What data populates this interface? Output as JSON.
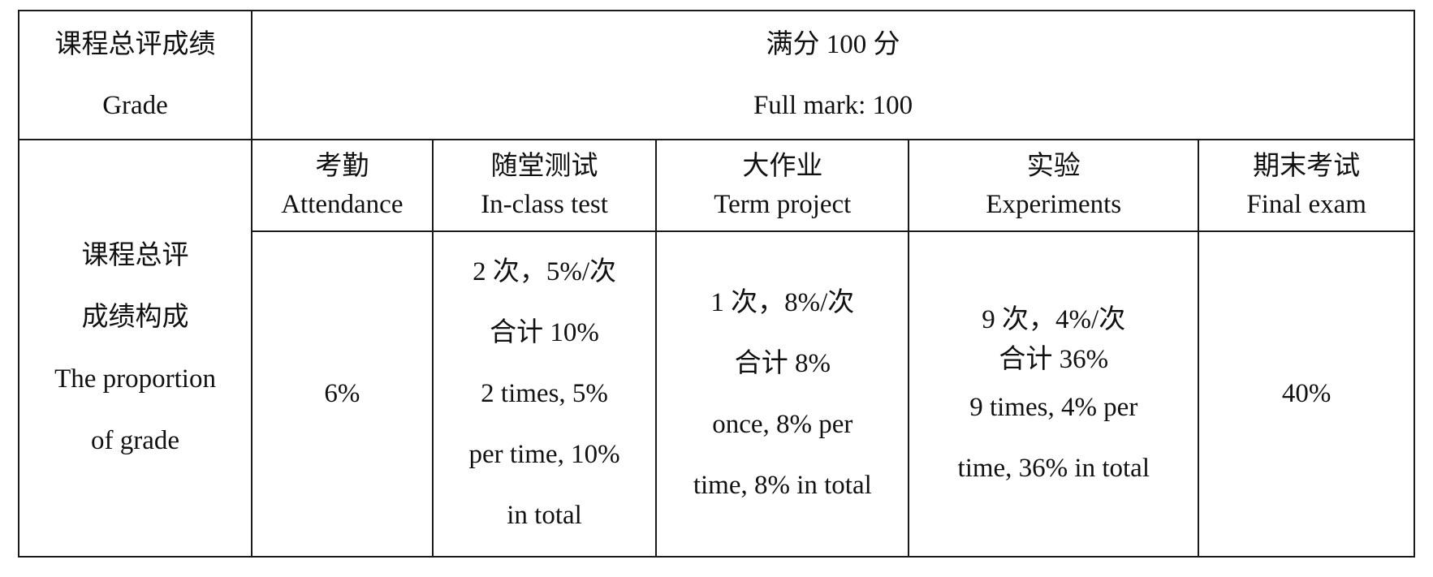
{
  "grade": {
    "label_zh": "课程总评成绩",
    "label_en": "Grade",
    "full_mark_zh": "满分 100 分",
    "full_mark_en": "Full mark: 100"
  },
  "proportion": {
    "label_lines": [
      "课程总评",
      "成绩构成",
      "The proportion",
      "of grade"
    ]
  },
  "components": [
    {
      "name_zh": "考勤",
      "name_en": "Attendance",
      "detail": [
        "6%"
      ]
    },
    {
      "name_zh": "随堂测试",
      "name_en": "In-class test",
      "detail": [
        "2 次，5%/次",
        "合计 10%",
        "2 times, 5%",
        "per time, 10%",
        "in total"
      ]
    },
    {
      "name_zh": "大作业",
      "name_en": "Term project",
      "detail": [
        "1 次，8%/次",
        "合计 8%",
        "once, 8% per",
        "time, 8% in total"
      ]
    },
    {
      "name_zh": "实验",
      "name_en": "Experiments",
      "detail": [
        "9 次，4%/次",
        "合计 36%",
        "9 times, 4% per",
        "time, 36% in total"
      ]
    },
    {
      "name_zh": "期末考试",
      "name_en": "Final exam",
      "detail": [
        "40%"
      ]
    }
  ]
}
